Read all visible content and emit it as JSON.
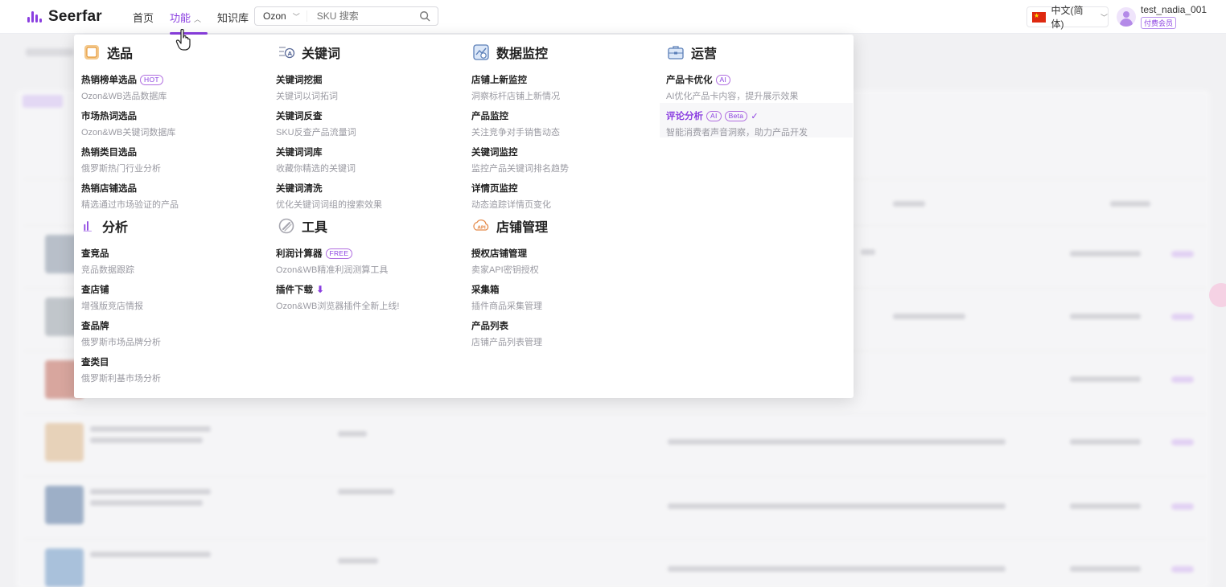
{
  "header": {
    "logo_text": "Seerfar",
    "nav": [
      {
        "label": "首页"
      },
      {
        "label": "功能"
      },
      {
        "label": "知识库"
      }
    ],
    "search": {
      "market": "Ozon",
      "placeholder": "SKU 搜索"
    },
    "language": "中文(简体)",
    "user": {
      "name": "test_nadia_001",
      "badge": "付费会员"
    }
  },
  "menu": {
    "xuanpin": {
      "title": "选品",
      "items": [
        {
          "title": "热销榜单选品",
          "tag": "HOT",
          "desc": "Ozon&WB选品数据库"
        },
        {
          "title": "市场热词选品",
          "desc": "Ozon&WB关键词数据库"
        },
        {
          "title": "热销类目选品",
          "desc": "俄罗斯热门行业分析"
        },
        {
          "title": "热销店铺选品",
          "desc": "精选通过市场验证的产品"
        }
      ]
    },
    "fenxi": {
      "title": "分析",
      "items": [
        {
          "title": "查竞品",
          "desc": "竞品数据跟踪"
        },
        {
          "title": "查店铺",
          "desc": "增强版竞店情报"
        },
        {
          "title": "查品牌",
          "desc": "俄罗斯市场品牌分析"
        },
        {
          "title": "查类目",
          "desc": "俄罗斯利基市场分析"
        }
      ]
    },
    "guanjianci": {
      "title": "关键词",
      "items": [
        {
          "title": "关键词挖掘",
          "desc": "关键词以词拓词"
        },
        {
          "title": "关键词反查",
          "desc": "SKU反查产品流量词"
        },
        {
          "title": "关键词词库",
          "desc": "收藏你精选的关键词"
        },
        {
          "title": "关键词清洗",
          "desc": "优化关键词词组的搜索效果"
        }
      ]
    },
    "gongju": {
      "title": "工具",
      "items": [
        {
          "title": "利润计算器",
          "tag": "FREE",
          "desc": "Ozon&WB精准利润测算工具"
        },
        {
          "title": "插件下载",
          "desc": "Ozon&WB浏览器插件全新上线!"
        }
      ]
    },
    "shuju": {
      "title": "数据监控",
      "items": [
        {
          "title": "店铺上新监控",
          "desc": "洞察标杆店铺上新情况"
        },
        {
          "title": "产品监控",
          "desc": "关注竞争对手销售动态"
        },
        {
          "title": "关键词监控",
          "desc": "监控产品关键词排名趋势"
        },
        {
          "title": "详情页监控",
          "desc": "动态追踪详情页变化"
        }
      ]
    },
    "dianpu": {
      "title": "店铺管理",
      "items": [
        {
          "title": "授权店铺管理",
          "desc": "卖家API密钥授权"
        },
        {
          "title": "采集箱",
          "desc": "插件商品采集管理"
        },
        {
          "title": "产品列表",
          "desc": "店铺产品列表管理"
        }
      ]
    },
    "yunying": {
      "title": "运营",
      "items": [
        {
          "title": "产品卡优化",
          "tag": "AI",
          "desc": "AI优化产品卡内容，提升展示效果"
        },
        {
          "title": "评论分析",
          "tag": "AI",
          "tag2": "Beta",
          "desc": "智能消费者声音洞察，助力产品开发"
        }
      ]
    }
  },
  "colors": {
    "accent": "#8a3ee0",
    "tag_border": "#b06ee0",
    "desc_text": "#9a9aa2"
  }
}
